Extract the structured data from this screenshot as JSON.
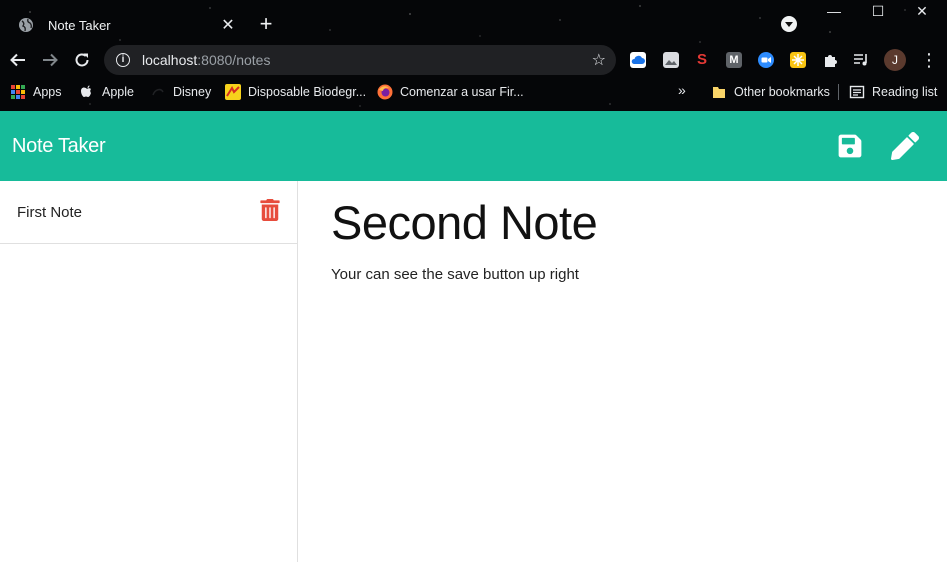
{
  "browser": {
    "tab_title": "Note Taker",
    "tab_close": "✕",
    "new_tab": "+",
    "url_host": "localhost",
    "url_rest": ":8080/notes",
    "window_controls": {
      "minimize": "—",
      "maximize": "☐",
      "close": "✕"
    },
    "avatar_initial": "J",
    "bookmarks": [
      {
        "label": "Apps",
        "icon": "apps-grid-icon"
      },
      {
        "label": "Apple",
        "icon": "apple-icon"
      },
      {
        "label": "Disney",
        "icon": "disney-icon"
      },
      {
        "label": "Disposable Biodegr...",
        "icon": "bookmark-favicon-icon"
      },
      {
        "label": "Comenzar a usar Fir...",
        "icon": "firefox-icon"
      }
    ],
    "bookmarks_overflow": "»",
    "other_bookmarks": "Other bookmarks",
    "reading_list": "Reading list"
  },
  "app": {
    "title": "Note Taker",
    "header_color": "#17bb9a",
    "notes": [
      {
        "title": "First Note"
      }
    ],
    "active_note": {
      "title": "Second Note",
      "text": "Your can see the save button up right"
    }
  }
}
